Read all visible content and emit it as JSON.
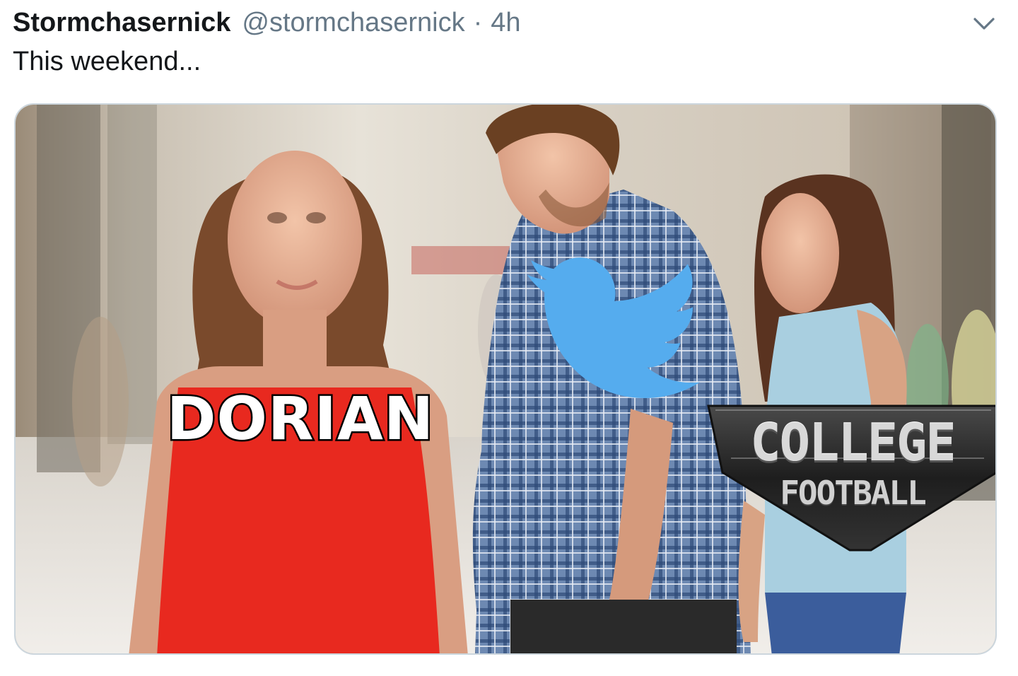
{
  "tweet": {
    "display_name": "Stormchasernick",
    "handle": "@stormchasernick",
    "separator": "·",
    "time": "4h",
    "text": "This weekend...",
    "menu_icon": "chevron-down-icon"
  },
  "media": {
    "label_left": "DORIAN",
    "label_right_top": "COLLEGE",
    "label_right_bottom": "FOOTBALL",
    "bird_icon": "twitter-bird-icon",
    "colors": {
      "twitter_blue": "#55acee",
      "dress_red": "#e8291f",
      "shirt_blue": "#5d7ba6",
      "top_light_blue": "#a9cfe0",
      "badge_dark": "#2b2b2b"
    }
  }
}
